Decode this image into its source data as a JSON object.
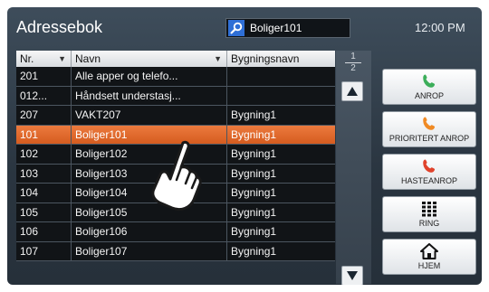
{
  "header": {
    "title": "Adressebok",
    "search_value": "Boliger101",
    "clock": "12:00 PM"
  },
  "table": {
    "columns": [
      {
        "label": "Nr."
      },
      {
        "label": "Navn"
      },
      {
        "label": "Bygningsnavn"
      }
    ],
    "rows": [
      {
        "nr": "201",
        "navn": "Alle apper og telefo...",
        "bygg": ""
      },
      {
        "nr": "012...",
        "navn": "Håndsett understasj...",
        "bygg": ""
      },
      {
        "nr": "207",
        "navn": "VAKT207",
        "bygg": "Bygning1"
      },
      {
        "nr": "101",
        "navn": "Boliger101",
        "bygg": "Bygning1"
      },
      {
        "nr": "102",
        "navn": "Boliger102",
        "bygg": "Bygning1"
      },
      {
        "nr": "103",
        "navn": "Boliger103",
        "bygg": "Bygning1"
      },
      {
        "nr": "104",
        "navn": "Boliger104",
        "bygg": "Bygning1"
      },
      {
        "nr": "105",
        "navn": "Boliger105",
        "bygg": "Bygning1"
      },
      {
        "nr": "106",
        "navn": "Boliger106",
        "bygg": "Bygning1"
      },
      {
        "nr": "107",
        "navn": "Boliger107",
        "bygg": "Bygning1"
      }
    ],
    "selected_row": 3
  },
  "pager": {
    "current": "1",
    "total": "2"
  },
  "side_buttons": [
    {
      "label": "ANROP",
      "icon": "phone-icon",
      "color": "#3cae5a"
    },
    {
      "label": "PRIORITERT ANROP",
      "icon": "phone-icon",
      "color": "#f08a24"
    },
    {
      "label": "HASTEANROP",
      "icon": "phone-icon",
      "color": "#e0422b"
    },
    {
      "label": "RING",
      "icon": "keypad-icon",
      "color": "#111111"
    },
    {
      "label": "HJEM",
      "icon": "home-icon",
      "color": "#111111"
    }
  ],
  "colors": {
    "selected": "#e46a2c",
    "search_icon": "#2f6fd6"
  }
}
